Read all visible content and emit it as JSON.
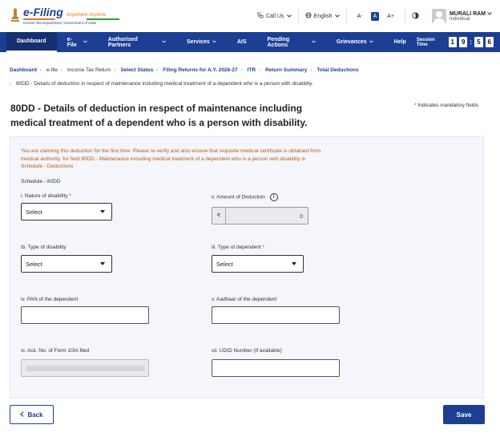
{
  "header": {
    "logo_title": "e-Filing",
    "logo_tagline": "Anywhere Anytime",
    "logo_sub": "Income Tax Department, Government of India",
    "call_us": "Call Us",
    "language": "English",
    "font_small": "A-",
    "font_normal": "A",
    "font_large": "A+",
    "user_name": "MURALI RAM",
    "user_role": "Individual"
  },
  "nav": {
    "items": [
      "Dashboard",
      "e-File",
      "Authorised Partners",
      "Services",
      "AIS",
      "Pending Actions",
      "Grievances",
      "Help"
    ],
    "session_label": "Session Time",
    "session_digits": [
      "1",
      "9",
      "5",
      "6"
    ]
  },
  "breadcrumb": {
    "items": [
      "Dashboard",
      "e-file",
      "Income Tax Return",
      "Select Status",
      "Filing Returns for A.Y. 2026-27",
      "ITR",
      "Return Summary",
      "Total Deductions"
    ],
    "current": "80DD - Details of deduction in respect of maintenance including medical treatment of a dependent who is a person with disability."
  },
  "page": {
    "title_line1": "80DD - Details of deduction in respect of maintenance including",
    "title_line2": "medical treatment of a dependent who is a person with disability.",
    "mandatory_star": "*",
    "mandatory_note": "Indicates mandatory fields"
  },
  "form": {
    "warning": "You are claiming this deduction for the first time. Please re-verify and also ensure that requisite medical certificate is obtained from medical authority. for field 80DD - Maintenance including medical treatment of a dependent who is a person with disability in Schedule - Deductions",
    "schedule": "Schedule - 80DD",
    "nature_label": "i. Nature of disability",
    "nature_value": "Select",
    "amount_label": "ii. Amount of Deduction",
    "amount_currency": "₹",
    "amount_value": "0",
    "type_disability_label": "ib. Type of disability",
    "type_disability_value": "Select",
    "type_dependent_label": "iii. Type of dependent",
    "type_dependent_value": "Select",
    "pan_label": "iv. PAN of the dependent",
    "pan_value": "",
    "aadhaar_label": "v. Aadhaar of the dependent",
    "aadhaar_value": "",
    "ack_label": "vi. Ack. No. of Form 10IA filed",
    "udid_label": "vii. UDID Number (If available)",
    "udid_value": "",
    "required_star": "*"
  },
  "actions": {
    "back": "Back",
    "save": "Save"
  },
  "colors": {
    "brand": "#1c3f94",
    "warning_text": "#b75a1a",
    "required": "#d52b1e"
  }
}
